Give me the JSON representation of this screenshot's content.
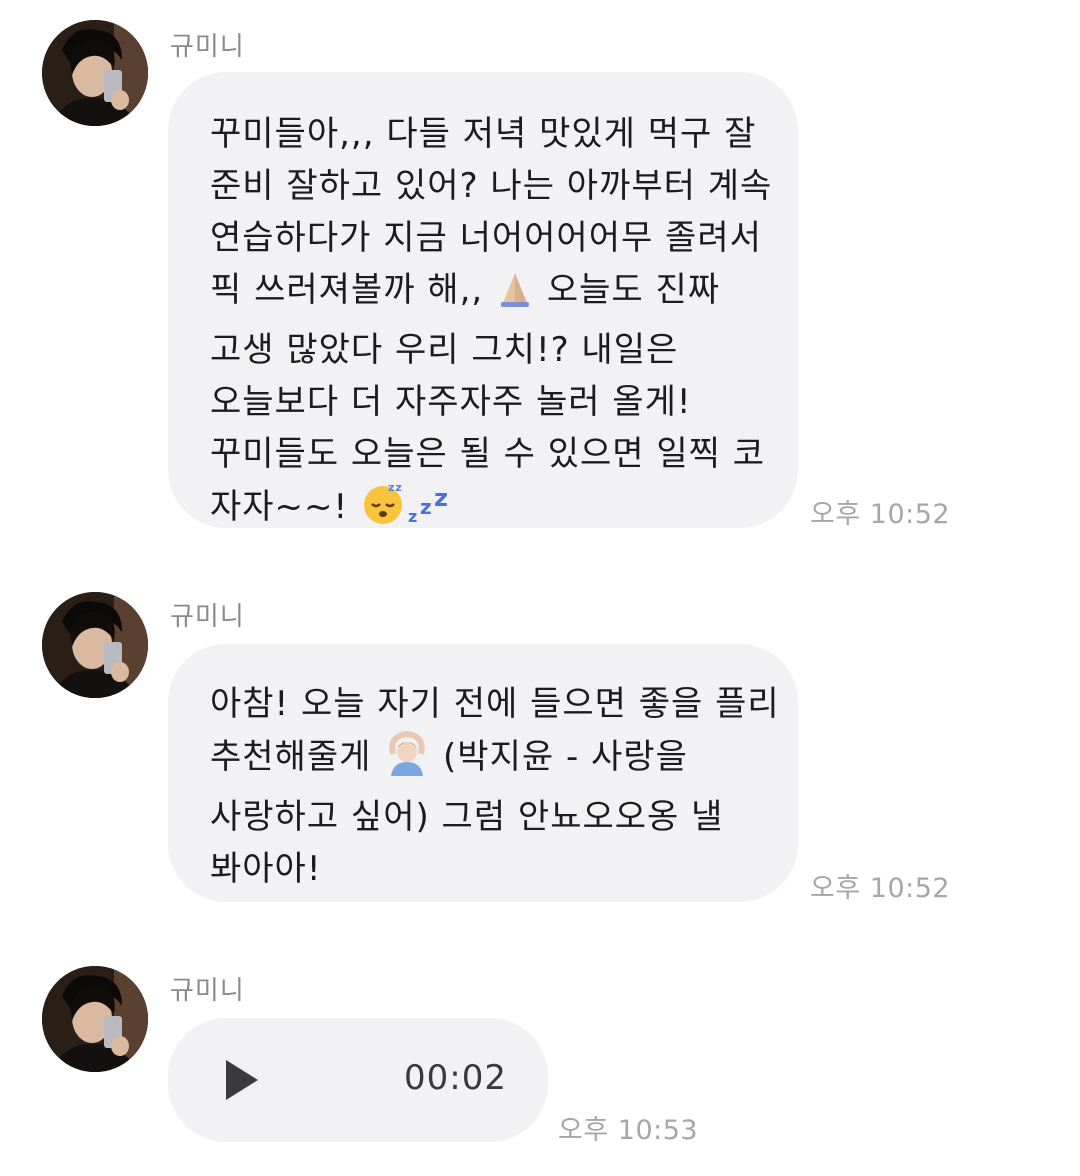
{
  "messages": [
    {
      "sender": "규미니",
      "lines": [
        "꾸미들아,,, 다들 저녁 맛있게 먹구 잘",
        "준비 잘하고 있어? 나는 아까부터 계속",
        "연습하다가 지금 너어어어어무 졸려서",
        "픽 쓰러져볼까 해,,",
        "오늘도 진짜",
        "고생 많았다 우리 그치!? 내일은",
        "오늘보다 더 자주자주 놀러 올게!",
        "꾸미들도 오늘은 될 수 있으면 일찍 코",
        "자자~~!"
      ],
      "time": "오후 10:52"
    },
    {
      "sender": "규미니",
      "lines": [
        "아참! 오늘 자기 전에 들으면 좋을 플리",
        "추천해줄게",
        "(박지윤 - 사랑을",
        "사랑하고 싶어) 그럼 안뇨오오옹 낼",
        "봐아아!"
      ],
      "time": "오후 10:52"
    },
    {
      "sender": "규미니",
      "voice_duration": "00:02",
      "time": "오후 10:53"
    }
  ],
  "icons": {
    "pray": "folded-hands-emoji",
    "sleep": "sleeping-face-emoji",
    "zzz": "zzz-emoji",
    "okay": "person-gesturing-ok-emoji",
    "play": "play-icon"
  },
  "colors": {
    "bubble": "#f2f2f5",
    "time": "#a7a7ab",
    "sender": "#8a8a8f"
  }
}
